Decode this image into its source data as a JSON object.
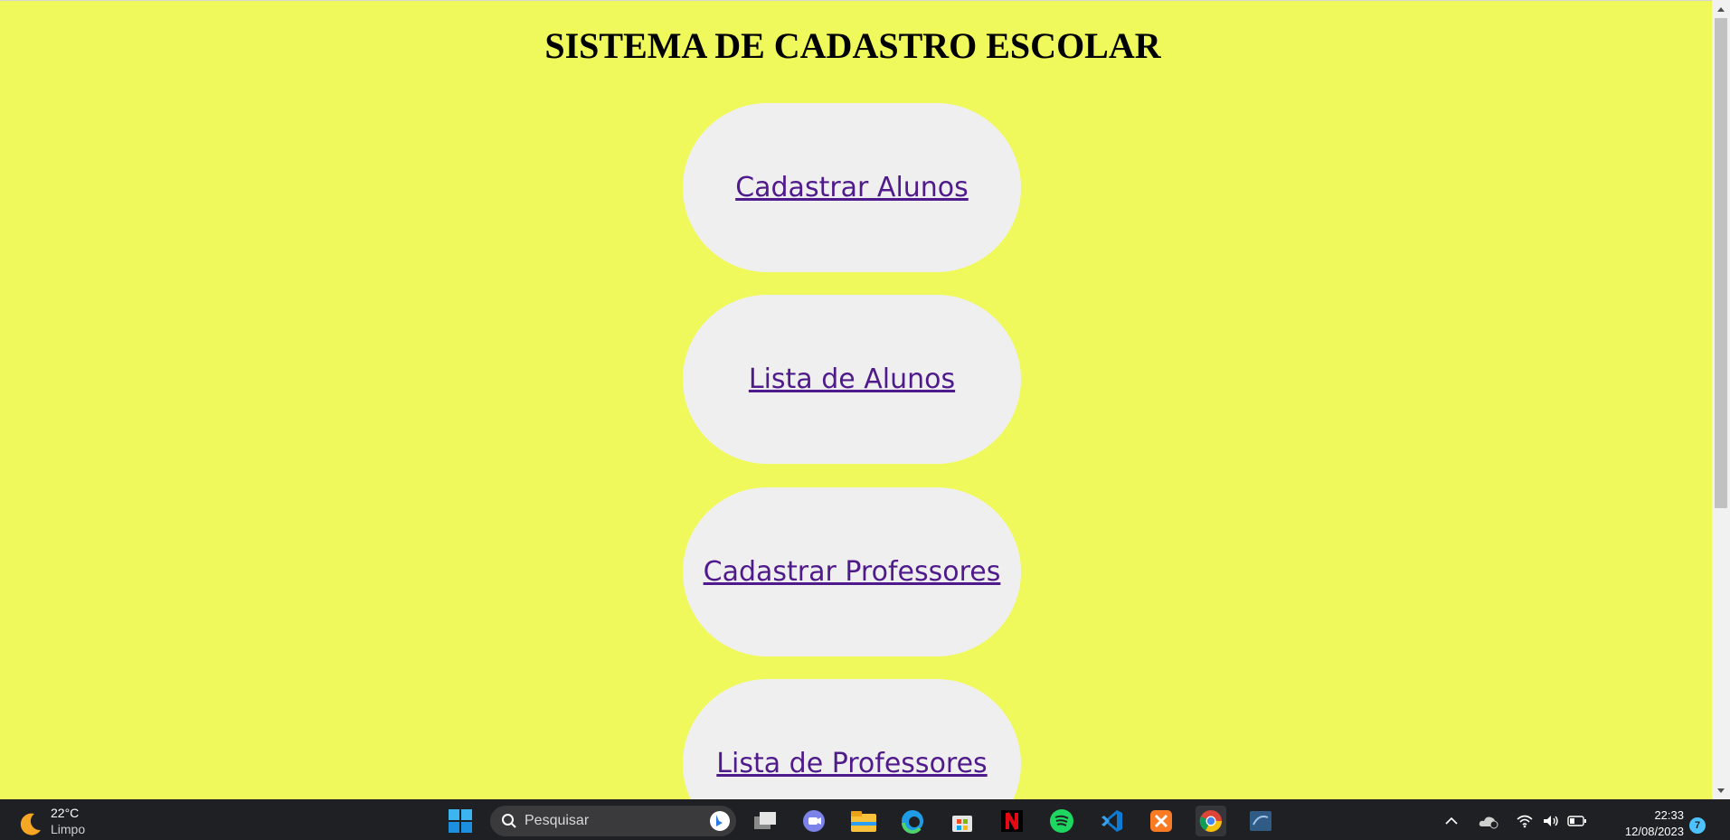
{
  "page": {
    "title": "SISTEMA DE CADASTRO ESCOLAR",
    "background_color": "#f0f95c",
    "link_color": "#4f1a8b",
    "menu": [
      {
        "label": "Cadastrar Alunos"
      },
      {
        "label": "Lista de Alunos"
      },
      {
        "label": "Cadastrar Professores"
      },
      {
        "label": "Lista de Professores"
      }
    ]
  },
  "taskbar": {
    "weather": {
      "temperature": "22°C",
      "condition": "Limpo",
      "icon": "moon-icon"
    },
    "search_placeholder": "Pesquisar",
    "apps": [
      "windows-start-icon",
      "task-view-icon",
      "teams-chat-icon",
      "file-explorer-icon",
      "edge-icon",
      "microsoft-store-icon",
      "netflix-icon",
      "spotify-icon",
      "vscode-icon",
      "xampp-icon",
      "chrome-icon",
      "mysql-workbench-icon"
    ],
    "tray": [
      "chevron-up-icon",
      "onedrive-icon",
      "wifi-icon",
      "volume-icon",
      "battery-icon"
    ],
    "time": "22:33",
    "date": "12/08/2023",
    "notification_count": "7"
  }
}
